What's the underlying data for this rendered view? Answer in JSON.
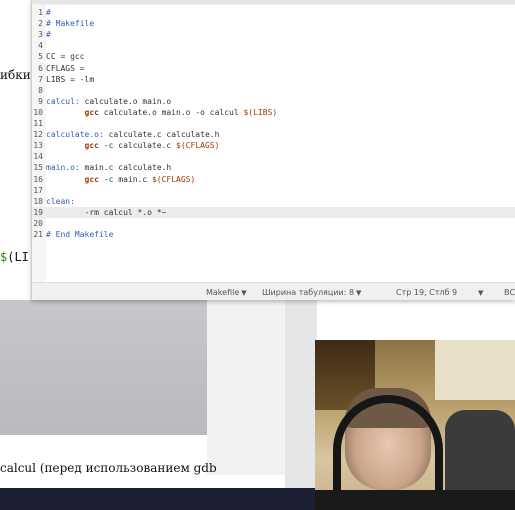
{
  "background_doc": {
    "left_text": "ибки",
    "code_snippet_dollar": "$",
    "code_snippet_rest": "(LI",
    "caption": "calcul (перед использованием gdb"
  },
  "editor": {
    "lines": [
      {
        "n": "1",
        "parts": [
          {
            "t": "#",
            "c": "comment"
          }
        ]
      },
      {
        "n": "2",
        "parts": [
          {
            "t": "# Makefile",
            "c": "comment"
          }
        ]
      },
      {
        "n": "3",
        "parts": [
          {
            "t": "#",
            "c": "comment"
          }
        ]
      },
      {
        "n": "4",
        "parts": []
      },
      {
        "n": "5",
        "parts": [
          {
            "t": "CC = gcc",
            "c": "plain"
          }
        ]
      },
      {
        "n": "6",
        "parts": [
          {
            "t": "CFLAGS =",
            "c": "plain"
          }
        ]
      },
      {
        "n": "7",
        "parts": [
          {
            "t": "LIBS = -lm",
            "c": "plain"
          }
        ]
      },
      {
        "n": "8",
        "parts": []
      },
      {
        "n": "9",
        "parts": [
          {
            "t": "calcul:",
            "c": "target"
          },
          {
            "t": " calculate.o main.o",
            "c": "plain"
          }
        ]
      },
      {
        "n": "10",
        "parts": [
          {
            "t": "        ",
            "c": "plain"
          },
          {
            "t": "gcc",
            "c": "kw"
          },
          {
            "t": " calculate.o main.o -o calcul ",
            "c": "plain"
          },
          {
            "t": "$(LIBS)",
            "c": "var"
          }
        ]
      },
      {
        "n": "11",
        "parts": []
      },
      {
        "n": "12",
        "parts": [
          {
            "t": "calculate.o:",
            "c": "target"
          },
          {
            "t": " calculate.c calculate.h",
            "c": "plain"
          }
        ]
      },
      {
        "n": "13",
        "parts": [
          {
            "t": "        ",
            "c": "plain"
          },
          {
            "t": "gcc",
            "c": "kw"
          },
          {
            "t": " -c calculate.c ",
            "c": "plain"
          },
          {
            "t": "$(CFLAGS)",
            "c": "var"
          }
        ]
      },
      {
        "n": "14",
        "parts": []
      },
      {
        "n": "15",
        "parts": [
          {
            "t": "main.o:",
            "c": "target"
          },
          {
            "t": " main.c calculate.h",
            "c": "plain"
          }
        ]
      },
      {
        "n": "16",
        "parts": [
          {
            "t": "        ",
            "c": "plain"
          },
          {
            "t": "gcc",
            "c": "kw"
          },
          {
            "t": " -c main.c ",
            "c": "plain"
          },
          {
            "t": "$(CFLAGS)",
            "c": "var"
          }
        ]
      },
      {
        "n": "17",
        "parts": []
      },
      {
        "n": "18",
        "parts": [
          {
            "t": "clean:",
            "c": "target"
          }
        ]
      },
      {
        "n": "19",
        "parts": [
          {
            "t": "        -rm calcul *.o *~",
            "c": "plain"
          }
        ],
        "current": true
      },
      {
        "n": "20",
        "parts": []
      },
      {
        "n": "21",
        "parts": [
          {
            "t": "# End Makefile",
            "c": "comment"
          }
        ]
      }
    ],
    "status": {
      "language": "Makefile",
      "tab_width": "Ширина табуляции: 8",
      "position": "Стр 19, Стлб 9",
      "insert_mode": "ВС"
    },
    "colors": {
      "comment": "#2f5fb6",
      "keyword": "#a03a00",
      "current_line": "#ececec"
    }
  },
  "webcam": {
    "label": "webcam-feed"
  }
}
